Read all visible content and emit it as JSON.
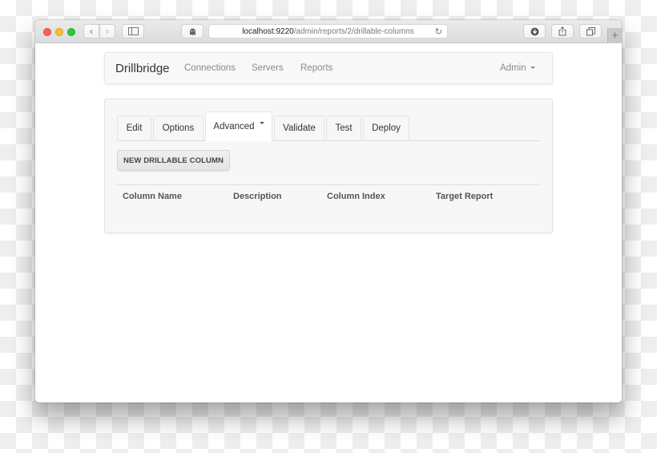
{
  "browser": {
    "url_host": "localhost:9220",
    "url_path": "/admin/reports/2/drillable-columns",
    "icons": {
      "back": "‹",
      "forward": "›",
      "sidebar": "▯",
      "extension": "☗",
      "reload": "↻",
      "download": "⬇",
      "share": "⇪",
      "tabs": "⧉",
      "new_tab": "+"
    }
  },
  "navbar": {
    "brand": "Drillbridge",
    "links": [
      "Connections",
      "Servers",
      "Reports"
    ],
    "user_menu": "Admin"
  },
  "tabs": [
    {
      "label": "Edit",
      "active": false
    },
    {
      "label": "Options",
      "active": false
    },
    {
      "label": "Advanced",
      "active": true,
      "dropdown": true
    },
    {
      "label": "Validate",
      "active": false
    },
    {
      "label": "Test",
      "active": false
    },
    {
      "label": "Deploy",
      "active": false
    }
  ],
  "actions": {
    "new_button": "NEW DRILLABLE COLUMN"
  },
  "table": {
    "columns": [
      "Column Name",
      "Description",
      "Column Index",
      "Target Report"
    ],
    "rows": []
  }
}
